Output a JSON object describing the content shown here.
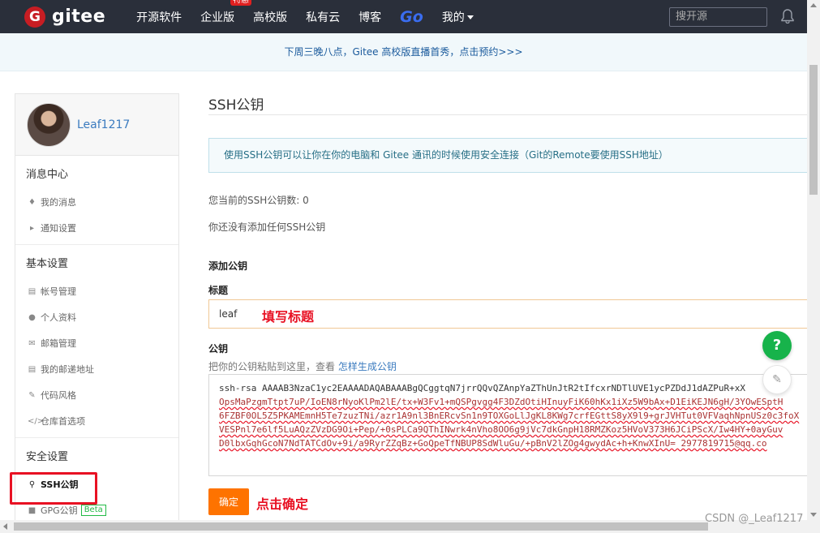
{
  "nav": {
    "logo_letter": "G",
    "logo_text": "gitee",
    "items": [
      "开源软件",
      "企业版",
      "高校版",
      "私有云",
      "博客"
    ],
    "badge": "特惠",
    "go_label": "Go",
    "mine_label": "我的",
    "search_placeholder": "搜开源",
    "bell_icon": "bell-icon"
  },
  "announcement": "下周三晚八点，Gitee 高校版直播首秀，点击预约>>>",
  "sidebar": {
    "username": "Leaf1217",
    "groups": [
      {
        "title": "消息中心",
        "items": [
          {
            "label": "我的消息",
            "icon": "bell-icon"
          },
          {
            "label": "通知设置",
            "icon": "speaker-icon"
          }
        ]
      },
      {
        "title": "基本设置",
        "items": [
          {
            "label": "帐号管理",
            "icon": "id-card-icon"
          },
          {
            "label": "个人资料",
            "icon": "user-icon"
          },
          {
            "label": "邮箱管理",
            "icon": "mail-icon"
          },
          {
            "label": "我的邮递地址",
            "icon": "address-icon"
          },
          {
            "label": "代码风格",
            "icon": "brush-icon"
          },
          {
            "label": "仓库首选项",
            "icon": "code-icon"
          }
        ]
      },
      {
        "title": "安全设置",
        "items": [
          {
            "label": "SSH公钥",
            "icon": "key-icon"
          },
          {
            "label": "GPG公钥",
            "icon": "lock-icon",
            "badge": "Beta"
          }
        ]
      }
    ]
  },
  "main": {
    "page_title": "SSH公钥",
    "info": "使用SSH公钥可以让你在你的电脑和 Gitee 通讯的时候使用安全连接（Git的Remote要使用SSH地址）",
    "count_text": "您当前的SSH公钥数: 0",
    "empty_text": "你还没有添加任何SSH公钥",
    "add_heading": "添加公钥",
    "title_label": "标题",
    "title_value": "leaf",
    "title_annotation": "填写标题",
    "key_label": "公钥",
    "key_hint": "把你的公钥粘贴到这里，查看",
    "key_hint_link": "怎样生成公钥",
    "key_lines": [
      "ssh-rsa AAAAB3NzaC1yc2EAAAADAQABAAABgQCggtqN7jrrQQvQZAnpYaZThUnJtR2tIfcxrNDTlUVE1ycPZDdJ1dAZPuR+xX",
      "OpsMaPzgmTtpt7uP/IoEN8rNyoKlPm2lE/tx+W3Fv1+mQSPgvgg4F3DZdOtiHInuyFiK60hKx1iXz5W9bAx+D1EiKEJN6gH/3YOwESptH",
      "6FZBF0OL5Z5PKAMEmnH5Te7zuzTNi/azr1A9nl3BnERcvSn1n9TOXGoLlJgKL8KWg7crfEGttS8yX9l9+grJVHTut0VFVaqhNpnUSz0c3foX",
      "VESPnl7e6lf5LuAQzZVzDG9Oi+Pep/+0sPLCa9QThINwrk4nVho8OO6g9jVc7dkGnpH18RMZKoz5HVoV373H6JCiPScX/Iw4HY+0ayGuv",
      "D0lbxGqhGcoN7NdTATCdOv+9i/a9RyrZZqBz+GoQpeTfNBUP8SdWluGu/+pBnV2lZOg4gwydAc+h+KnwXInU= 2977819715@qq.co"
    ],
    "confirm_label": "确定",
    "confirm_annotation": "点击确定"
  },
  "floating": {
    "help_label": "?",
    "edit_icon": "edit-icon"
  },
  "watermark": "CSDN @_Leaf1217",
  "colors": {
    "nav_bg": "#2a2f3a",
    "brand": "#c71d23",
    "primary_btn": "#fe7300",
    "link": "#3b7bbf",
    "annotation": "#e81123",
    "help_btn": "#17b34b"
  }
}
